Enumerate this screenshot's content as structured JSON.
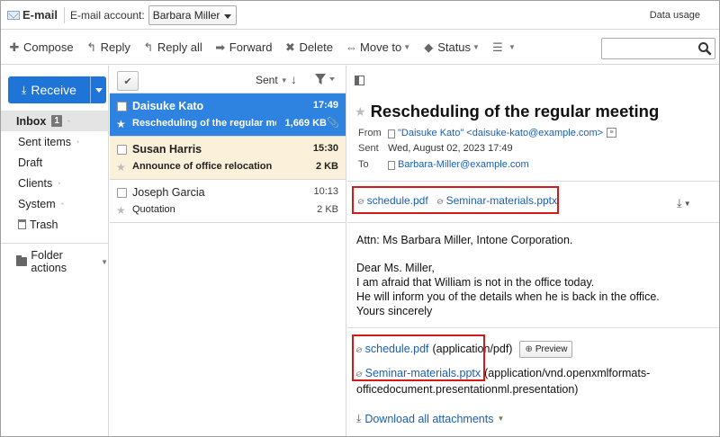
{
  "topbar": {
    "app_title": "E-mail",
    "account_label": "E-mail account:",
    "account_value": "Barbara Miller",
    "data_usage": "Data usage"
  },
  "toolbar": {
    "compose": "Compose",
    "reply": "Reply",
    "reply_all": "Reply all",
    "forward": "Forward",
    "delete": "Delete",
    "move_to": "Move to",
    "status": "Status"
  },
  "sidebar": {
    "receive": "Receive",
    "folders": [
      {
        "label": "Inbox",
        "badge": "1"
      },
      {
        "label": "Sent items"
      },
      {
        "label": "Draft"
      },
      {
        "label": "Clients"
      },
      {
        "label": "System"
      },
      {
        "label": "Trash"
      }
    ],
    "folder_actions": "Folder actions"
  },
  "list": {
    "sort_label": "Sent",
    "messages": [
      {
        "sender": "Daisuke Kato",
        "time": "17:49",
        "subject": "Rescheduling of the regular me...",
        "size": "1,669 KB",
        "state": "selected"
      },
      {
        "sender": "Susan Harris",
        "time": "15:30",
        "subject": "Announce of office relocation",
        "size": "2 KB",
        "state": "unread"
      },
      {
        "sender": "Joseph Garcia",
        "time": "10:13",
        "subject": "Quotation",
        "size": "2 KB",
        "state": "read"
      }
    ]
  },
  "message": {
    "subject": "Rescheduling of the regular meeting",
    "from_label": "From",
    "from_value": "\"Daisuke Kato\" <daisuke-kato@example.com>",
    "sent_label": "Sent",
    "sent_value": "Wed, August 02, 2023 17:49",
    "to_label": "To",
    "to_value": "Barbara-Miller@example.com",
    "attachments_top": [
      "schedule.pdf",
      "Seminar-materials.pptx"
    ],
    "body": {
      "line1": "Attn: Ms Barbara Miller, Intone Corporation.",
      "line2": "Dear Ms. Miller,",
      "line3": "I am afraid that William is not in the office today.",
      "line4": "He will inform you of the details when he is back in the office.",
      "line5": "Yours sincerely"
    },
    "attachments": [
      {
        "name": "schedule.pdf",
        "type": "(application/pdf)"
      },
      {
        "name": "Seminar-materials.pptx",
        "type": "(application/vnd.openxmlformats-",
        "type_cont": "officedocument.presentationml.presentation)"
      }
    ],
    "preview_label": "Preview",
    "download_all": "Download all attachments"
  },
  "colors": {
    "accent": "#1f74d7",
    "selected_row": "#2f83e0",
    "unread_row": "#fbf0d9",
    "highlight_box": "#d31a1a",
    "link": "#1a5fb4"
  }
}
